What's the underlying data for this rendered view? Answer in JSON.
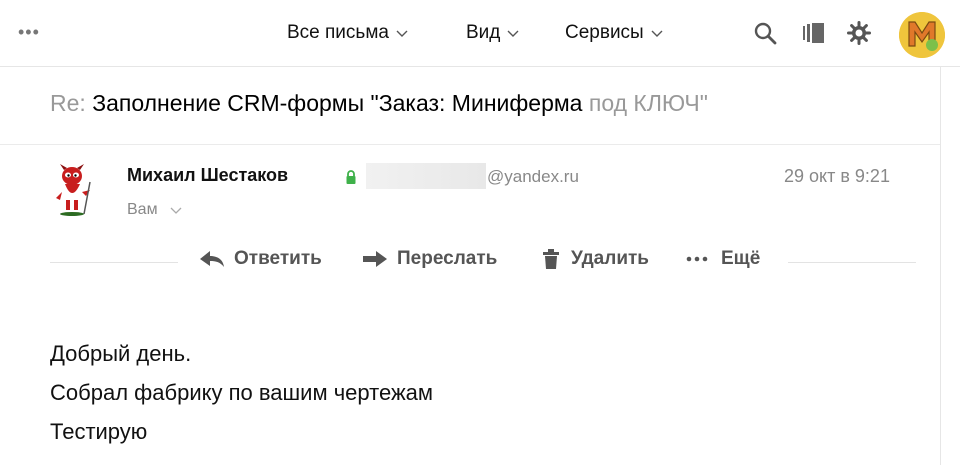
{
  "toolbar": {
    "more_dots": "•••",
    "menus": [
      "Все письма",
      "Вид",
      "Сервисы"
    ],
    "icons": [
      "search-icon",
      "layout-icon",
      "gear-icon"
    ],
    "avatar": "user-avatar"
  },
  "message": {
    "subject_prefix": "Re:",
    "subject_main": "Заполнение CRM-формы \"Заказ: Миниферма ",
    "subject_faded": "под КЛЮЧ\"",
    "sender_name": "Михаил Шестаков",
    "sender_domain": "@yandex.ru",
    "date": "29 окт в 9:21",
    "recipient": "Вам",
    "actions": {
      "reply": "Ответить",
      "forward": "Переслать",
      "delete": "Удалить",
      "more": "Ещё"
    },
    "body": [
      "Добрый день.",
      "Собрал фабрику по вашим чертежам",
      "Тестирую"
    ]
  },
  "colors": {
    "muted": "#888888",
    "lock": "#3fb14a",
    "avatar_bg": "#f0c23a"
  }
}
